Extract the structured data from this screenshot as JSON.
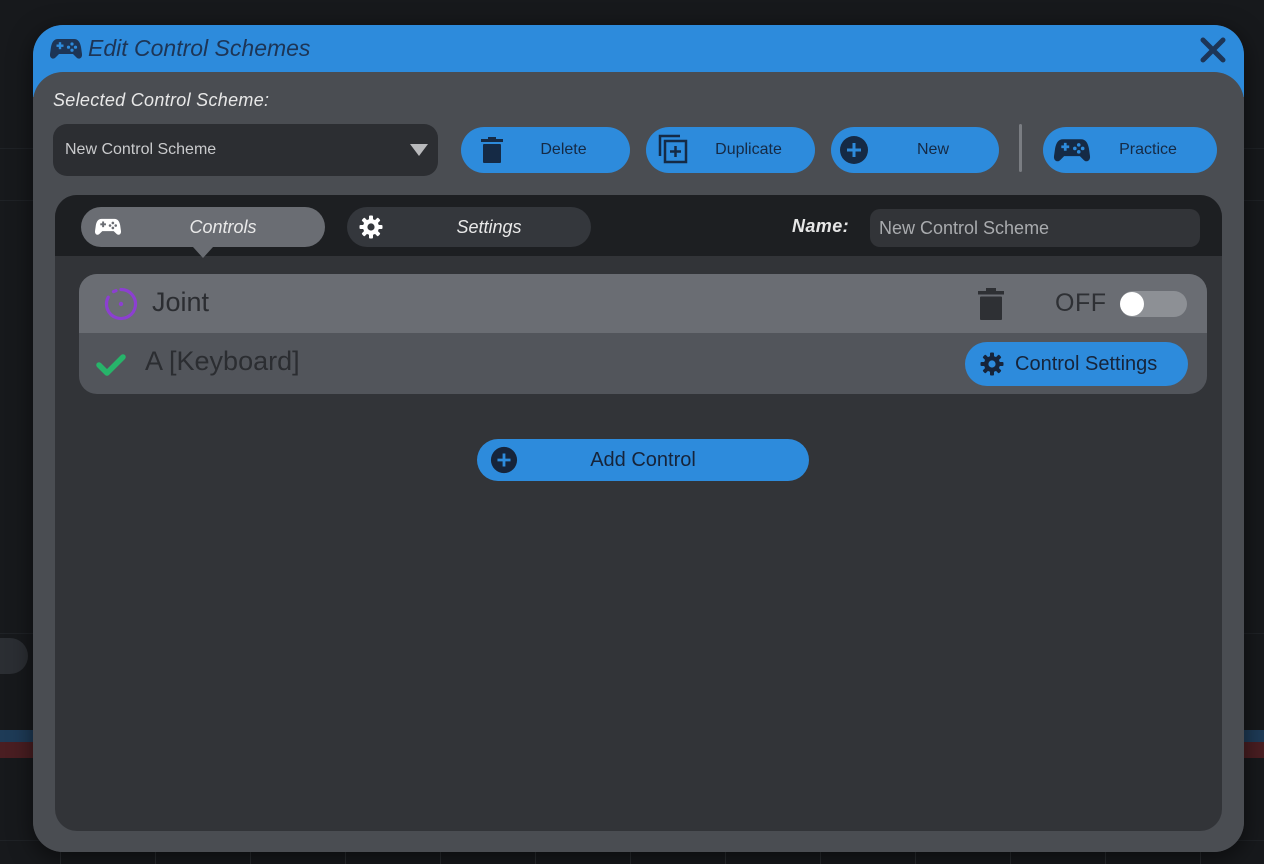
{
  "colors": {
    "accent": "#2d8bdc",
    "dialog_bg": "#4a4d52",
    "panel_bg": "#323438",
    "tab_bar_bg": "#1d1f22",
    "check_green": "#27b46a",
    "joint_purple": "#8c3fd1"
  },
  "dialog": {
    "title": "Edit Control Schemes",
    "title_icon": "gamepad-icon",
    "close_icon": "close-icon"
  },
  "scheme": {
    "label": "Selected Control Scheme:",
    "selected": "New Control Scheme"
  },
  "toolbar": {
    "delete_label": "Delete",
    "duplicate_label": "Duplicate",
    "new_label": "New",
    "practice_label": "Practice"
  },
  "tabs": {
    "controls_label": "Controls",
    "settings_label": "Settings",
    "active": "Controls"
  },
  "name_field": {
    "label": "Name:",
    "value": "New Control Scheme"
  },
  "control": {
    "type_label": "Joint",
    "toggle_label": "OFF",
    "toggle_on": false,
    "binding_label": "A [Keyboard]",
    "settings_button": "Control Settings"
  },
  "add_control_label": "Add Control"
}
